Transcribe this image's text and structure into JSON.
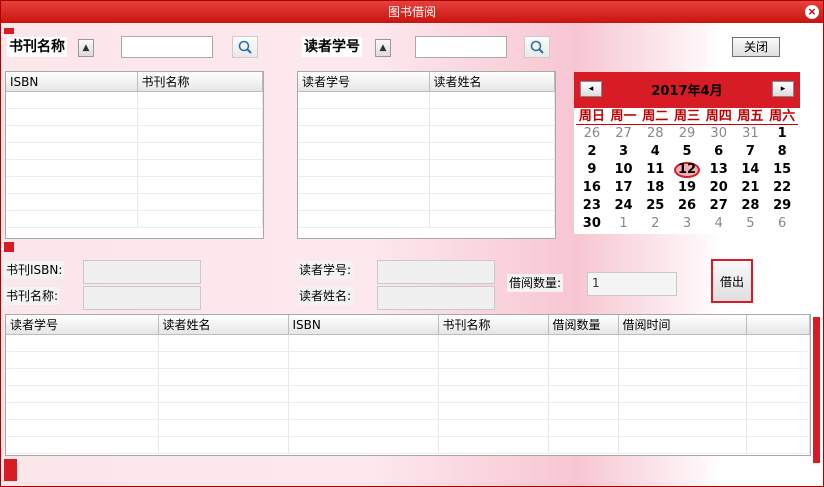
{
  "window": {
    "title": "图书借阅",
    "close_glyph": "×"
  },
  "book_search": {
    "field_label": "书刊名称",
    "query": ""
  },
  "reader_search": {
    "field_label": "读者学号",
    "query": ""
  },
  "close_button": "关闭",
  "book_grid": {
    "columns": [
      "ISBN",
      "书刊名称"
    ]
  },
  "reader_grid": {
    "columns": [
      "读者学号",
      "读者姓名"
    ]
  },
  "calendar": {
    "title": "2017年4月",
    "prev_glyph": "◂",
    "next_glyph": "▸",
    "weekdays": [
      "周日",
      "周一",
      "周二",
      "周三",
      "周四",
      "周五",
      "周六"
    ],
    "days": [
      {
        "d": "26",
        "dim": true
      },
      {
        "d": "27",
        "dim": true
      },
      {
        "d": "28",
        "dim": true
      },
      {
        "d": "29",
        "dim": true
      },
      {
        "d": "30",
        "dim": true
      },
      {
        "d": "31",
        "dim": true
      },
      {
        "d": "1"
      },
      {
        "d": "2"
      },
      {
        "d": "3"
      },
      {
        "d": "4"
      },
      {
        "d": "5"
      },
      {
        "d": "6"
      },
      {
        "d": "7"
      },
      {
        "d": "8"
      },
      {
        "d": "9"
      },
      {
        "d": "10"
      },
      {
        "d": "11"
      },
      {
        "d": "12",
        "today": true
      },
      {
        "d": "13"
      },
      {
        "d": "14"
      },
      {
        "d": "15"
      },
      {
        "d": "16"
      },
      {
        "d": "17"
      },
      {
        "d": "18"
      },
      {
        "d": "19"
      },
      {
        "d": "20"
      },
      {
        "d": "21"
      },
      {
        "d": "22"
      },
      {
        "d": "23"
      },
      {
        "d": "24"
      },
      {
        "d": "25"
      },
      {
        "d": "26"
      },
      {
        "d": "27"
      },
      {
        "d": "28"
      },
      {
        "d": "29"
      },
      {
        "d": "30"
      },
      {
        "d": "1",
        "dim": true
      },
      {
        "d": "2",
        "dim": true
      },
      {
        "d": "3",
        "dim": true
      },
      {
        "d": "4",
        "dim": true
      },
      {
        "d": "5",
        "dim": true
      },
      {
        "d": "6",
        "dim": true
      }
    ]
  },
  "detail": {
    "book_isbn_label": "书刊ISBN:",
    "book_name_label": "书刊名称:",
    "reader_id_label": "读者学号:",
    "reader_name_label": "读者姓名:",
    "quantity_label": "借阅数量:",
    "quantity_value": "1",
    "borrow_button": "借出"
  },
  "loan_grid": {
    "columns": [
      "读者学号",
      "读者姓名",
      "ISBN",
      "书刊名称",
      "借阅数量",
      "借阅时间"
    ]
  },
  "colors": {
    "accent_red": "#d81c25",
    "titlebar": "#c8140e"
  },
  "icons": {
    "search": "search-icon",
    "combo": "chevron-down-icon"
  }
}
